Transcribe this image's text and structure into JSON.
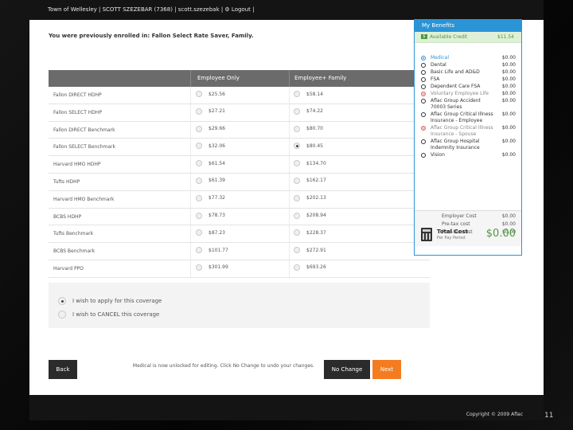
{
  "header": {
    "text": "Town of Wellesley | SCOTT SZEZEBAR (7368) | scott.szezebak | ⚙ Logout |"
  },
  "enrollment": {
    "message": "You were previously enrolled in: Fallon Select Rate Saver, Family."
  },
  "plans_table": {
    "columns": [
      "",
      "Employee Only",
      "Employee+ Family"
    ],
    "rows": [
      {
        "name": "Fallon DIRECT HDHP",
        "employee_only": "$25.56",
        "employee_family": "$58.14",
        "selected": ""
      },
      {
        "name": "Fallon SELECT HDHP",
        "employee_only": "$27.21",
        "employee_family": "$74.22",
        "selected": ""
      },
      {
        "name": "Fallon DIRECT Benchmark",
        "employee_only": "$29.66",
        "employee_family": "$80.70",
        "selected": ""
      },
      {
        "name": "Fallon SELECT Benchmark",
        "employee_only": "$32.06",
        "employee_family": "$80.45",
        "selected": "family"
      },
      {
        "name": "Harvard HMO HDHP",
        "employee_only": "$61.54",
        "employee_family": "$134.70",
        "selected": ""
      },
      {
        "name": "Tufts HDHP",
        "employee_only": "$61.39",
        "employee_family": "$162.17",
        "selected": ""
      },
      {
        "name": "Harvard HMO Benchmark",
        "employee_only": "$77.32",
        "employee_family": "$202.13",
        "selected": ""
      },
      {
        "name": "BCBS HDHP",
        "employee_only": "$78.73",
        "employee_family": "$208.94",
        "selected": ""
      },
      {
        "name": "Tufts Benchmark",
        "employee_only": "$87.23",
        "employee_family": "$228.37",
        "selected": ""
      },
      {
        "name": "BCBS Benchmark",
        "employee_only": "$101.77",
        "employee_family": "$272.91",
        "selected": ""
      },
      {
        "name": "Harvard PPO",
        "employee_only": "$301.99",
        "employee_family": "$693.26",
        "selected": ""
      }
    ]
  },
  "coverage": {
    "options": [
      {
        "label": "I wish to apply for this coverage",
        "selected": true
      },
      {
        "label": "I wish to CANCEL this coverage",
        "selected": false
      }
    ]
  },
  "actions": {
    "back_label": "Back",
    "notice": "Medical is now unlocked for editing. Click No Change to undo your changes.",
    "no_change_label": "No Change",
    "next_label": "Next"
  },
  "footer": {
    "copyright": "Copyright © 2009 Aflac"
  },
  "benefits_panel": {
    "title": "My Benefits",
    "credit_label": "Available Credit",
    "credit_value": "$11.54",
    "items": [
      {
        "name": "Medical",
        "cost": "$0.00",
        "state": "active"
      },
      {
        "name": "Dental",
        "cost": "$0.00",
        "state": "normal"
      },
      {
        "name": "Basic Life and AD&D",
        "cost": "$0.00",
        "state": "normal"
      },
      {
        "name": "FSA",
        "cost": "$0.00",
        "state": "normal"
      },
      {
        "name": "Dependent Care FSA",
        "cost": "$0.00",
        "state": "normal"
      },
      {
        "name": "Voluntary Employee Life",
        "cost": "$0.00",
        "state": "declined"
      },
      {
        "name": "Aflac Group Accident 70003 Series",
        "cost": "$0.00",
        "state": "normal"
      },
      {
        "name": "Aflac Group Critical Illness Insurance - Employee",
        "cost": "$0.00",
        "state": "normal"
      },
      {
        "name": "Aflac Group Critical Illness Insurance - Spouse",
        "cost": "$0.00",
        "state": "declined"
      },
      {
        "name": "Aflac Group Hospital Indemnity Insurance",
        "cost": "$0.00",
        "state": "normal"
      },
      {
        "name": "Vision",
        "cost": "$0.00",
        "state": "normal"
      }
    ],
    "summary": [
      {
        "label": "Employer Cost",
        "value": "$0.00"
      },
      {
        "label": "Pre-tax cost",
        "value": "$0.00"
      },
      {
        "label": "Post-tax cost",
        "value": "$0.00"
      }
    ],
    "total_label": "Total Cost",
    "total_sub": "Per Pay Period",
    "total_value": "$0.00"
  },
  "slide": {
    "page_number": "11"
  }
}
